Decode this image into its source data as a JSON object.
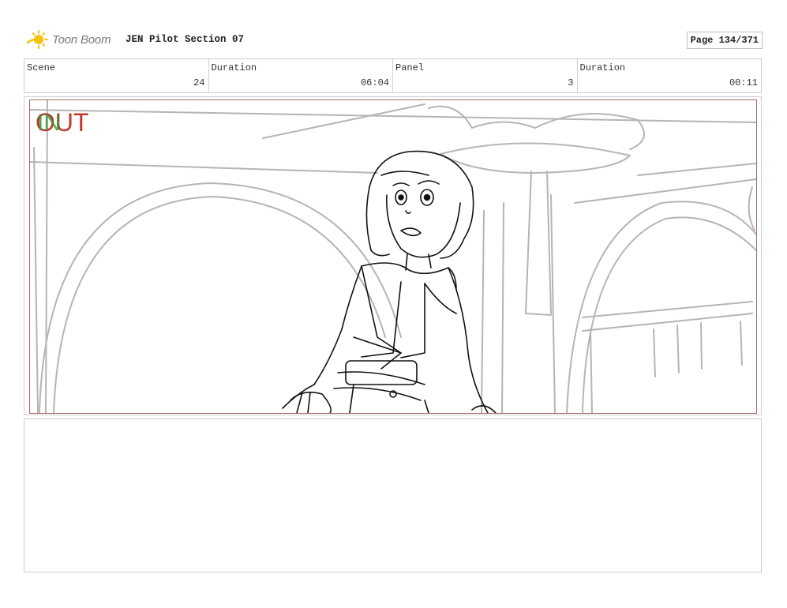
{
  "header": {
    "logo_text": "Toon Boom",
    "project_title": "JEN Pilot Section 07",
    "page_label": "Page 134/371"
  },
  "info": [
    {
      "label": "Scene",
      "value": "24"
    },
    {
      "label": "Duration",
      "value": "06:04"
    },
    {
      "label": "Panel",
      "value": "3"
    },
    {
      "label": "Duration",
      "value": "00:11"
    }
  ],
  "panel": {
    "overlay_out": "OUT",
    "overlay_in": "IN",
    "colors": {
      "out": "#c0392b",
      "in": "#2e9e3a",
      "frame": "#a56a63"
    }
  },
  "notes": {
    "text": ""
  }
}
